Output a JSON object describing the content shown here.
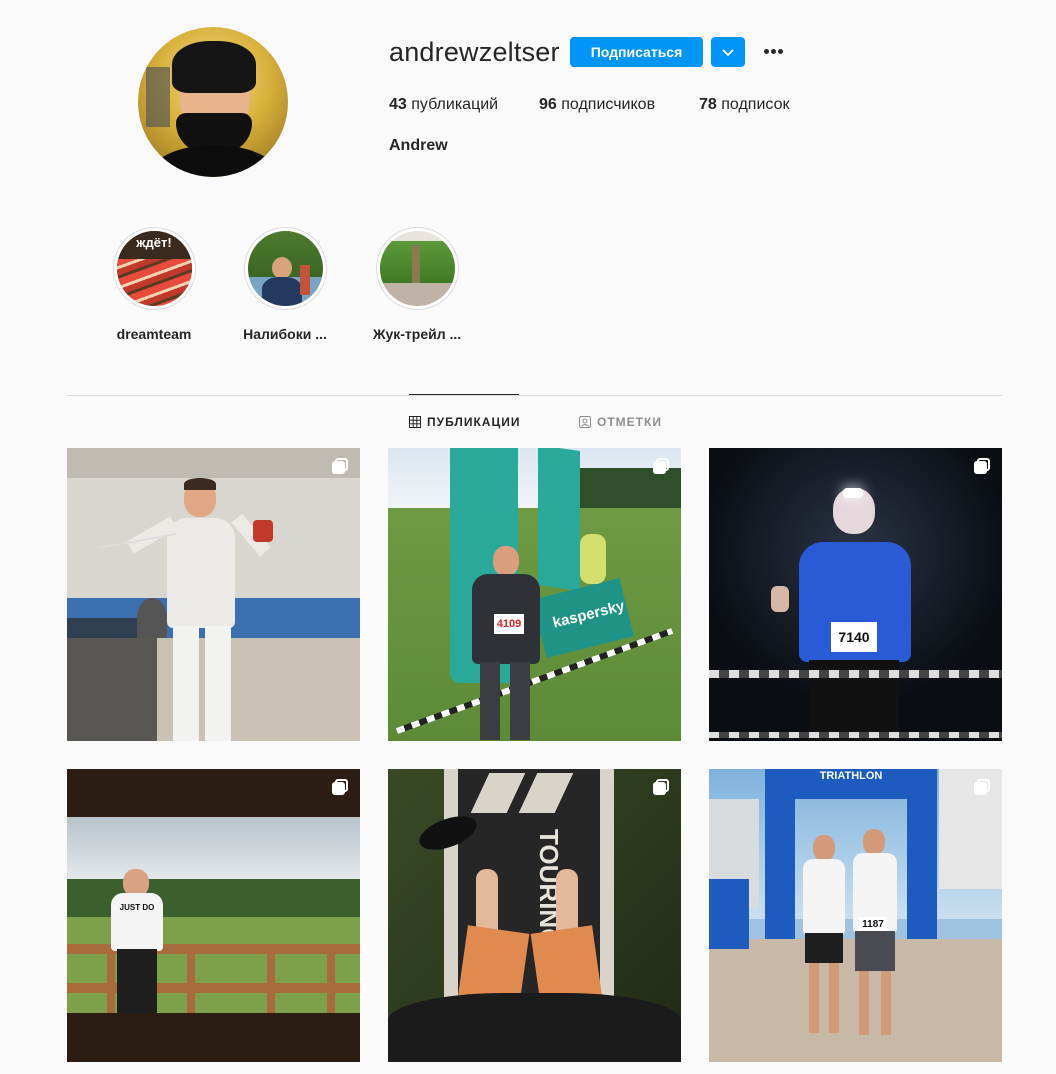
{
  "profile": {
    "username": "andrewzeltser",
    "full_name": "Andrew",
    "follow_label": "Подписаться",
    "stats": {
      "posts_count": "43",
      "posts_label": "публикаций",
      "followers_count": "96",
      "followers_label": "подписчиков",
      "following_count": "78",
      "following_label": "подписок"
    }
  },
  "highlights": [
    {
      "label": "dreamteam",
      "badge": "ждёт!"
    },
    {
      "label": "Налибоки ..."
    },
    {
      "label": "Жук-трейл ..."
    }
  ],
  "tabs": [
    {
      "label": "ПУБЛИКАЦИИ",
      "icon": "grid-icon",
      "active": true
    },
    {
      "label": "ОТМЕТКИ",
      "icon": "tagged-icon",
      "active": false
    }
  ],
  "posts": [
    {
      "id": 1,
      "scene": "fencer-in-gym",
      "multi": true
    },
    {
      "id": 2,
      "scene": "runner-kaspersky",
      "multi": true,
      "banner_text": "kaspersky",
      "bib": "4109"
    },
    {
      "id": 3,
      "scene": "night-run-headlamp",
      "multi": true,
      "bib": "7140"
    },
    {
      "id": 4,
      "scene": "man-on-balcony",
      "multi": true,
      "shirt_text": "JUST DO"
    },
    {
      "id": 5,
      "scene": "sup-board-feet",
      "multi": true,
      "board_text": "TOURING"
    },
    {
      "id": 6,
      "scene": "triathlon-finish",
      "multi": true,
      "arch_text": "TRIATHLON",
      "bib": "1187"
    }
  ],
  "colors": {
    "accent": "#0095f6",
    "text": "#262626",
    "muted": "#8e8e8e",
    "border": "#dbdbdb",
    "background": "#fafafa"
  }
}
